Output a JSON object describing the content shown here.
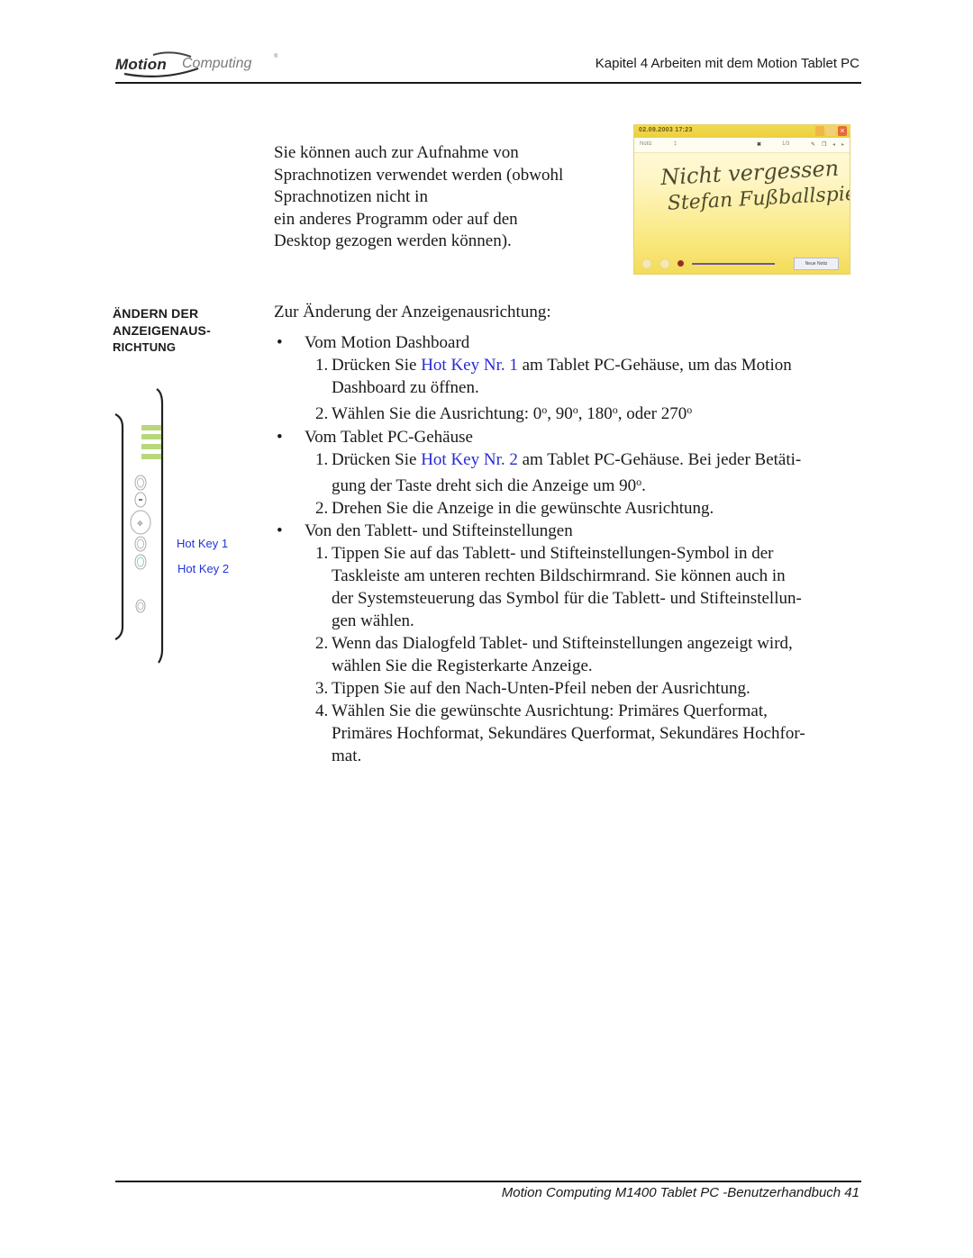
{
  "header": {
    "logo_primary": "Motion",
    "logo_secondary": "Computing",
    "logo_mark": "®",
    "chapter_title": "Kapitel 4 Arbeiten mit dem Motion Tablet PC"
  },
  "intro": {
    "lines": [
      "Sie können auch zur Aufnahme von",
      "Sprachnotizen verwendet werden (obwohl",
      "Sprachnotizen nicht in",
      "ein anderes Programm oder auf den",
      "Desktop gezogen werden können)."
    ]
  },
  "note_window": {
    "title": "02.09.2003 17:23",
    "toolbar_label": "Notiz",
    "page_indicator": "1/3",
    "handwriting_line1": "Nicht vergessen",
    "handwriting_line2": "Stefan Fußballspiel!",
    "new_note_button": "Neue Notiz",
    "close_glyph": "×",
    "accent_color": "#f3d950"
  },
  "sidebar": {
    "heading_lines": [
      "ÄNDERN DER",
      "ANZEIGENAUS-",
      "RICHTUNG"
    ],
    "hotkey1_label": "Hot Key 1",
    "hotkey2_label": "Hot Key 2",
    "hotkey_color": "#2233dd",
    "indicator_color": "#b7d77a"
  },
  "main": {
    "intro": "Zur Änderung der Anzeigenausrichtung:",
    "sections": [
      {
        "bullet": "•",
        "title": "Vom Motion Dashboard",
        "steps": [
          {
            "num": "1.",
            "pre": "Drücken Sie ",
            "link": "Hot Key Nr. 1",
            "post": " am Tablet PC-Gehäuse, um das Motion",
            "cont": "Dashboard zu öffnen."
          },
          {
            "num": "2.",
            "text": "Wählen Sie die Ausrichtung: 0",
            "deg": "o",
            "t2": ", 90",
            "t3": ", 180",
            "t4": ", oder 270"
          }
        ]
      },
      {
        "bullet": "•",
        "title": "Vom Tablet PC-Gehäuse",
        "steps": [
          {
            "num": "1.",
            "pre": "Drücken Sie ",
            "link": "Hot Key Nr. 2",
            "post": " am Tablet PC-Gehäuse. Bei jeder Betäti-",
            "cont": "gung der Taste dreht sich die Anzeige um 90",
            "cont_end": "."
          },
          {
            "num": "2.",
            "text": "Drehen Sie die Anzeige in die gewünschte Ausrichtung."
          }
        ]
      },
      {
        "bullet": "•",
        "title": "Von den Tablett- und Stifteinstellungen",
        "steps": [
          {
            "num": "1.",
            "lines": [
              "Tippen Sie auf das Tablett- und Stifteinstellungen-Symbol in der",
              "Taskleiste am unteren rechten Bildschirmrand. Sie können auch in",
              "der Systemsteuerung das Symbol für die Tablett- und Stifteinstellun-",
              "gen wählen."
            ]
          },
          {
            "num": "2.",
            "lines": [
              "Wenn das Dialogfeld Tablet- und Stifteinstellungen angezeigt wird,",
              "wählen Sie die Registerkarte Anzeige."
            ]
          },
          {
            "num": "3.",
            "lines": [
              "Tippen Sie auf den Nach-Unten-Pfeil neben der Ausrichtung."
            ]
          },
          {
            "num": "4.",
            "lines": [
              "Wählen Sie die gewünschte Ausrichtung: Primäres Querformat,",
              "Primäres Hochformat, Sekundäres Querformat, Sekundäres Hochfor-",
              "mat."
            ]
          }
        ]
      }
    ]
  },
  "footer": {
    "text": "Motion Computing M1400 Tablet PC -Benutzerhandbuch 41"
  }
}
